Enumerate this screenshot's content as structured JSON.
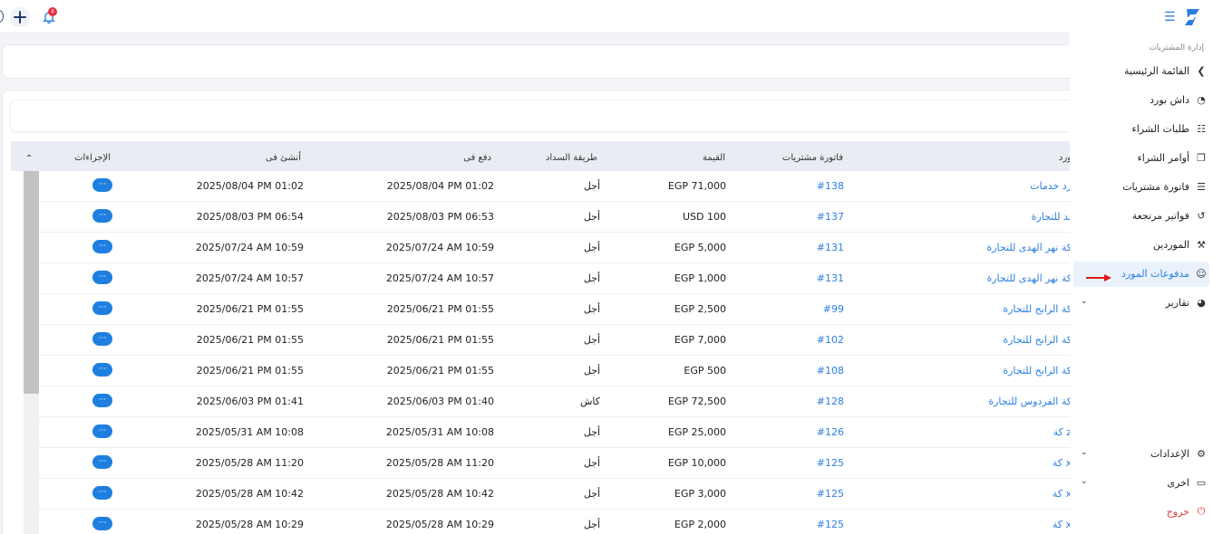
{
  "topbar": {
    "notification_count": "٥"
  },
  "sidebar": {
    "section": "إدارة المشتريات",
    "items": [
      {
        "label": "القائمة الرئيسية",
        "icon": "chevron-left-icon"
      },
      {
        "label": "داش بورد",
        "icon": "dashboard-icon"
      },
      {
        "label": "طلبات الشراء",
        "icon": "purchase-requests-icon"
      },
      {
        "label": "أوامر الشراء",
        "icon": "purchase-orders-icon"
      },
      {
        "label": "فاتورة مشتريات",
        "icon": "invoice-icon"
      },
      {
        "label": "فواتير مرتجعة",
        "icon": "returns-icon"
      },
      {
        "label": "الموردين",
        "icon": "suppliers-icon"
      },
      {
        "label": "مدفوعات المورد",
        "icon": "supplier-payments-icon",
        "active": true
      },
      {
        "label": "تقارير",
        "icon": "reports-icon",
        "chevron": true
      }
    ],
    "bottom_items": [
      {
        "label": "الإعدادات",
        "icon": "gear-icon",
        "chevron": true
      },
      {
        "label": "اخرى",
        "icon": "screen-icon",
        "chevron": true
      },
      {
        "label": "خروج",
        "icon": "power-icon"
      }
    ]
  },
  "table": {
    "headers": {
      "supplier": "ورد",
      "invoice": "فاتورة مشتريات",
      "amount": "القيمة",
      "method": "طريقة السداد",
      "paid_at": "دفع فى",
      "created_at": "أنشئ فى",
      "actions": "الإجراءات"
    },
    "action_label": "···",
    "rows": [
      {
        "supplier": "رد خدمات",
        "invoice": "#138",
        "amount": "EGP 71,000",
        "method": "أجل",
        "paid_at": "2025/08/04 PM 01:02",
        "created_at": "2025/08/04 PM 01:02"
      },
      {
        "supplier": "ـد للتجارة",
        "invoice": "#137",
        "amount": "USD 100",
        "method": "أجل",
        "paid_at": "2025/08/03 PM 06:53",
        "created_at": "2025/08/03 PM 06:54"
      },
      {
        "supplier": "كة  نهر الهدى للتجارة",
        "invoice": "#131",
        "amount": "EGP 5,000",
        "method": "أجل",
        "paid_at": "2025/07/24 AM 10:59",
        "created_at": "2025/07/24 AM 10:59"
      },
      {
        "supplier": "كة  نهر الهدى للتجارة",
        "invoice": "#131",
        "amount": "EGP 1,000",
        "method": "أجل",
        "paid_at": "2025/07/24 AM 10:57",
        "created_at": "2025/07/24 AM 10:57"
      },
      {
        "supplier": "كة الرابح للتجارة",
        "invoice": "#99",
        "amount": "EGP 2,500",
        "method": "أجل",
        "paid_at": "2025/06/21 PM 01:55",
        "created_at": "2025/06/21 PM 01:55"
      },
      {
        "supplier": "كة الرابح للتجارة",
        "invoice": "#102",
        "amount": "EGP 7,000",
        "method": "أجل",
        "paid_at": "2025/06/21 PM 01:55",
        "created_at": "2025/06/21 PM 01:55"
      },
      {
        "supplier": "كة الرابح للتجارة",
        "invoice": "#108",
        "amount": "EGP 500",
        "method": "أجل",
        "paid_at": "2025/06/21 PM 01:55",
        "created_at": "2025/06/21 PM 01:55"
      },
      {
        "supplier": "كة الفردوس للتجارة",
        "invoice": "#128",
        "amount": "EGP 72,500",
        "method": "كاش",
        "paid_at": "2025/06/03 PM 01:40",
        "created_at": "2025/06/03 PM 01:41"
      },
      {
        "supplier": "كة z",
        "invoice": "#126",
        "amount": "EGP 25,000",
        "method": "أجل",
        "paid_at": "2025/05/31 AM 10:08",
        "created_at": "2025/05/31 AM 10:08"
      },
      {
        "supplier": "كة x",
        "invoice": "#125",
        "amount": "EGP 10,000",
        "method": "أجل",
        "paid_at": "2025/05/28 AM 11:20",
        "created_at": "2025/05/28 AM 11:20"
      },
      {
        "supplier": "كة x",
        "invoice": "#125",
        "amount": "EGP 3,000",
        "method": "أجل",
        "paid_at": "2025/05/28 AM 10:42",
        "created_at": "2025/05/28 AM 10:42"
      },
      {
        "supplier": "كة x",
        "invoice": "#125",
        "amount": "EGP 2,000",
        "method": "أجل",
        "paid_at": "2025/05/28 AM 10:29",
        "created_at": "2025/05/28 AM 10:29"
      }
    ]
  },
  "colors": {
    "accent": "#2c7fe0",
    "danger": "#e03a3a",
    "header_bg": "#e9edf3"
  }
}
